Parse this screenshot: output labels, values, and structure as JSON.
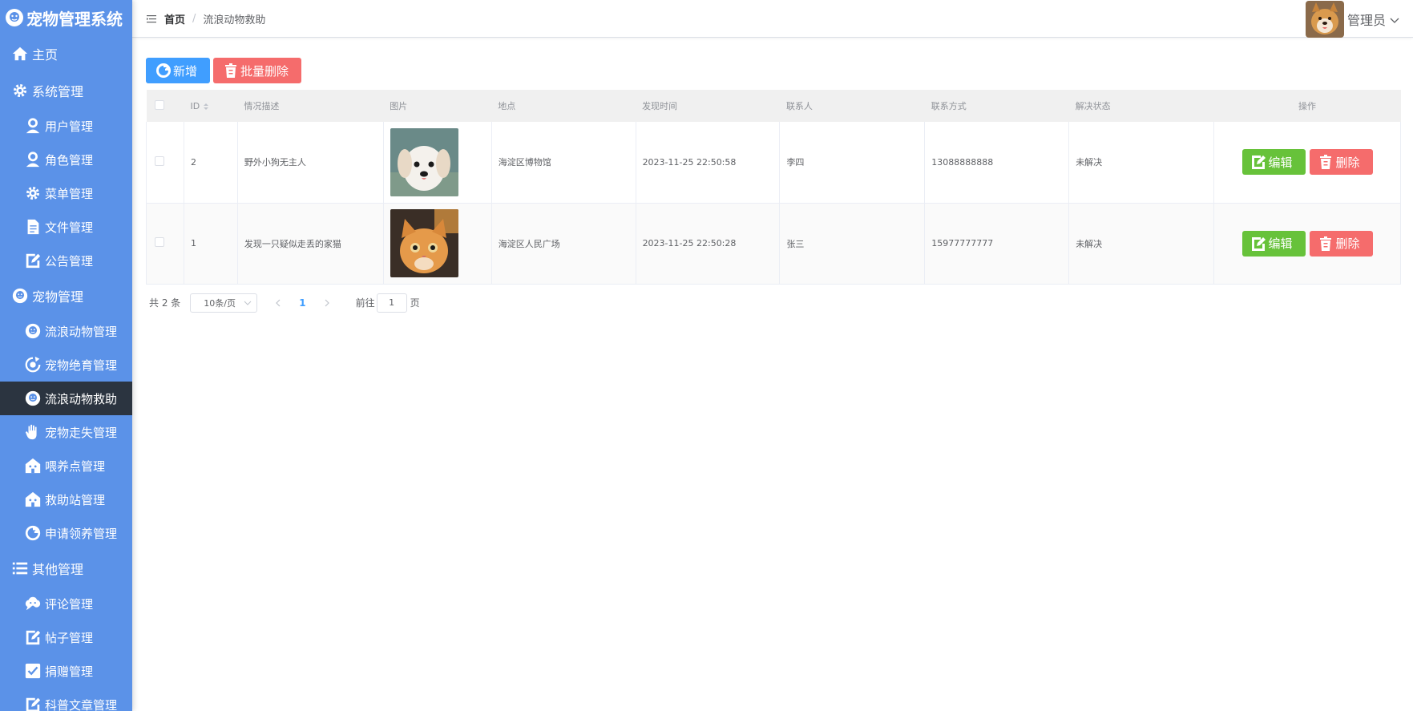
{
  "app": {
    "title": "宠物管理系统"
  },
  "sidebar": {
    "items": [
      {
        "type": "group",
        "label": "主页",
        "icon": "home-icon"
      },
      {
        "type": "group",
        "label": "系统管理",
        "icon": "gear-icon"
      },
      {
        "type": "item",
        "label": "用户管理",
        "icon": "user-icon"
      },
      {
        "type": "item",
        "label": "角色管理",
        "icon": "user-icon"
      },
      {
        "type": "item",
        "label": "菜单管理",
        "icon": "gear-icon"
      },
      {
        "type": "item",
        "label": "文件管理",
        "icon": "document-icon"
      },
      {
        "type": "item",
        "label": "公告管理",
        "icon": "edit-icon"
      },
      {
        "type": "group",
        "label": "宠物管理",
        "icon": "pet-icon"
      },
      {
        "type": "item",
        "label": "流浪动物管理",
        "icon": "pet-icon"
      },
      {
        "type": "item",
        "label": "宠物绝育管理",
        "icon": "refresh-icon"
      },
      {
        "type": "item",
        "label": "流浪动物救助",
        "icon": "pet-icon",
        "active": true
      },
      {
        "type": "item",
        "label": "宠物走失管理",
        "icon": "hand-icon"
      },
      {
        "type": "item",
        "label": "喂养点管理",
        "icon": "house-icon"
      },
      {
        "type": "item",
        "label": "救助站管理",
        "icon": "house-icon"
      },
      {
        "type": "item",
        "label": "申请领养管理",
        "icon": "compass-icon"
      },
      {
        "type": "group",
        "label": "其他管理",
        "icon": "list-icon"
      },
      {
        "type": "item",
        "label": "评论管理",
        "icon": "comment-icon"
      },
      {
        "type": "item",
        "label": "帖子管理",
        "icon": "edit-icon"
      },
      {
        "type": "item",
        "label": "捐赠管理",
        "icon": "check-icon"
      },
      {
        "type": "item",
        "label": "科普文章管理",
        "icon": "edit-icon"
      }
    ]
  },
  "header": {
    "breadcrumb_home": "首页",
    "breadcrumb_sep": "/",
    "breadcrumb_current": "流浪动物救助",
    "username": "管理员"
  },
  "toolbar": {
    "add_label": "新增",
    "batch_delete_label": "批量删除"
  },
  "table": {
    "columns": [
      "ID",
      "情况描述",
      "图片",
      "地点",
      "发现时间",
      "联系人",
      "联系方式",
      "解决状态",
      "操作"
    ],
    "rows": [
      {
        "id": "2",
        "desc": "野外小狗无主人",
        "image": "puppy-photo",
        "place": "海淀区博物馆",
        "time": "2023-11-25 22:50:58",
        "contact": "李四",
        "phone": "13088888888",
        "status": "未解决"
      },
      {
        "id": "1",
        "desc": "发现一只疑似走丢的家猫",
        "image": "cat-photo",
        "place": "海淀区人民广场",
        "time": "2023-11-25 22:50:28",
        "contact": "张三",
        "phone": "15977777777",
        "status": "未解决"
      }
    ],
    "edit_label": "编辑",
    "delete_label": "删除"
  },
  "pagination": {
    "total": "共 2 条",
    "page_size": "10条/页",
    "current_page": "1",
    "goto_prefix": "前往",
    "goto_value": "1",
    "goto_suffix": "页"
  },
  "colors": {
    "sidebar": "#5b92e8",
    "active": "#2b3440",
    "primary": "#409eff",
    "danger": "#f56c6c",
    "success": "#67c23a"
  }
}
